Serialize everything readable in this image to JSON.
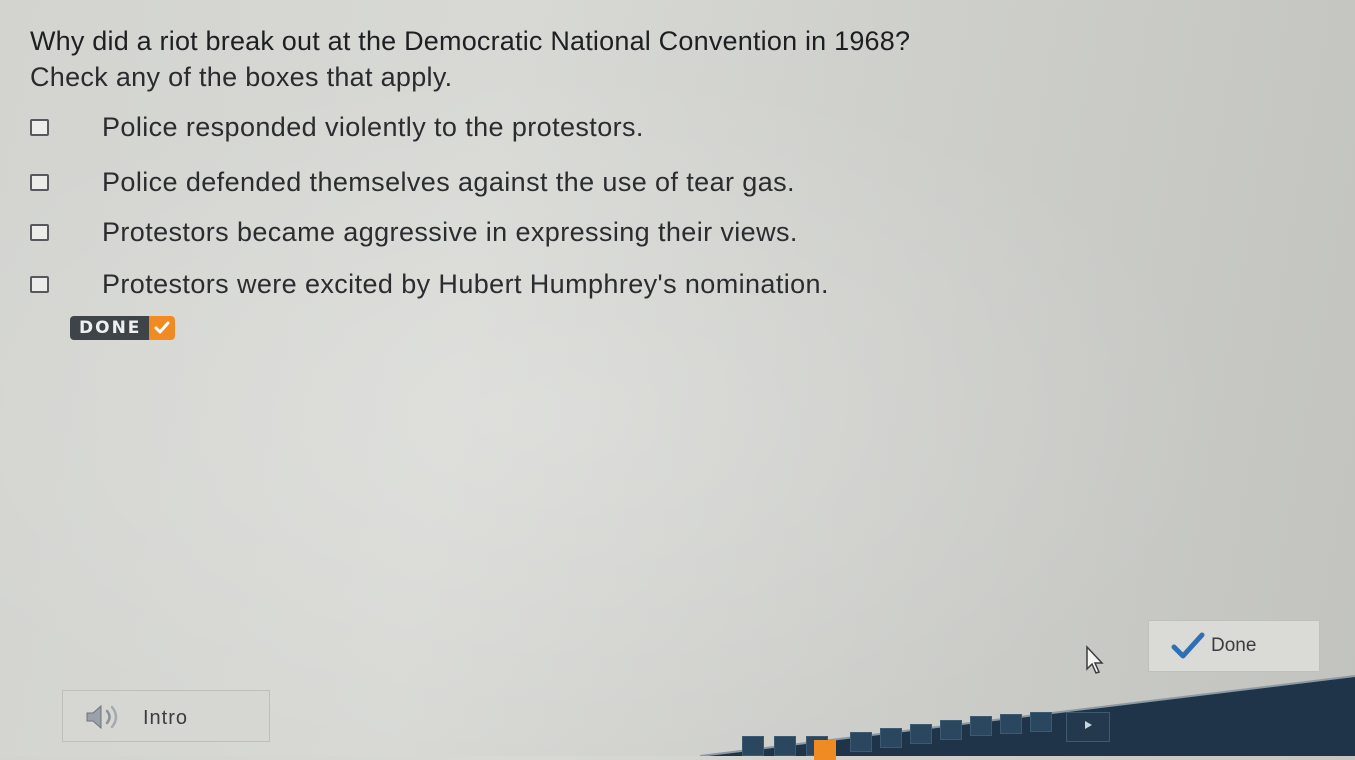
{
  "question": {
    "text": "Why did a riot break out at the Democratic National Convention in 1968?",
    "instruction": "Check any of the boxes that apply."
  },
  "options": [
    {
      "label": "Police responded violently to the protestors.",
      "checked": false
    },
    {
      "label": "Police defended themselves against the use of tear gas.",
      "checked": false
    },
    {
      "label": "Protestors became aggressive in expressing their views.",
      "checked": false
    },
    {
      "label": "Protestors were excited by Hubert Humphrey's nomination.",
      "checked": false
    }
  ],
  "done_badge": {
    "label": "DONE",
    "icon": "check-icon"
  },
  "done_button": {
    "label": "Done",
    "icon": "checkmark-icon"
  },
  "intro_button": {
    "label": "Intro",
    "icon": "speaker-icon"
  },
  "navigation": {
    "current_index": 3,
    "next_icon": "play-arrow-icon"
  },
  "colors": {
    "accent_orange": "#f08a22",
    "done_badge_dark": "#3f4448",
    "check_blue": "#2f6fb5",
    "nav_bar_blue": "#1f3448"
  }
}
